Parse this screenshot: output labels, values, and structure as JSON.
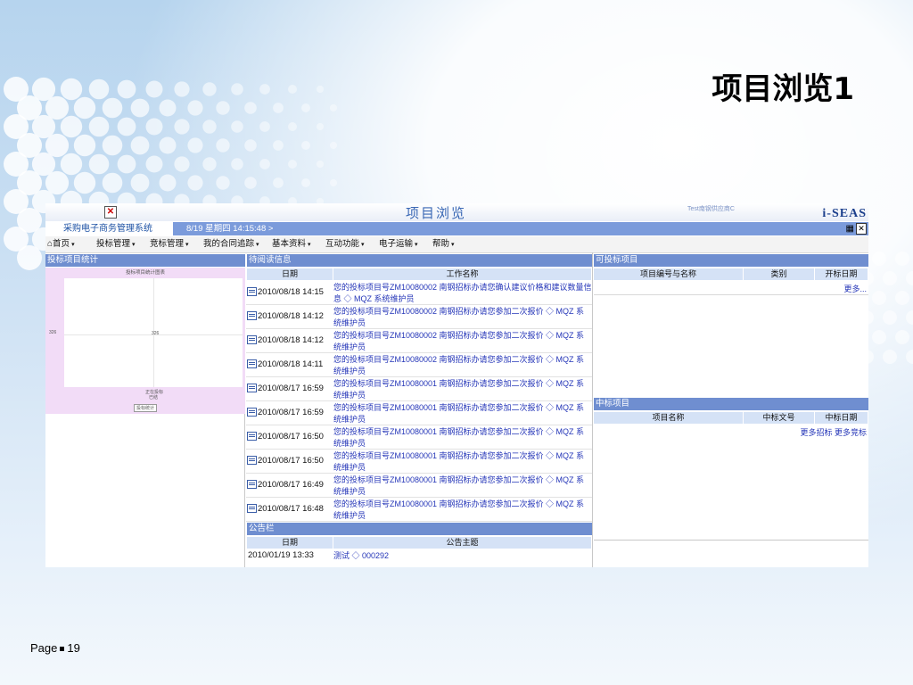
{
  "slide": {
    "title": "项目浏览1",
    "page_label": "Page",
    "page_number": "19"
  },
  "window": {
    "title": "项目浏览",
    "close_glyph": "✕",
    "user_text": "Test南钢供应商C",
    "logo": "i-SEAS",
    "system_name": "采购电子商务管理系统",
    "datetime": "8/19 星期四  14:15:48 >"
  },
  "menu": [
    {
      "label": "首页",
      "icon": "home-icon"
    },
    {
      "label": "投标管理"
    },
    {
      "label": "竞标管理"
    },
    {
      "label": "我的合同追踪"
    },
    {
      "label": "基本资料"
    },
    {
      "label": "互动功能"
    },
    {
      "label": "电子运输"
    },
    {
      "label": "帮助"
    }
  ],
  "stats_panel": {
    "header": "投标项目统计",
    "chart_title": "投标项目统计图表",
    "y_value": "326",
    "x_labels": [
      "正在投标",
      "已结"
    ],
    "button_label": "投标统计"
  },
  "pending_panel": {
    "header": "待阅读信息",
    "columns": [
      "日期",
      "工作名称"
    ],
    "rows": [
      {
        "date": "2010/08/18 14:15",
        "text": "您的投标项目号ZM10080002 南钢招标办请您确认建议价格和建议数量信息 ◇ MQZ 系统维护员"
      },
      {
        "date": "2010/08/18 14:12",
        "text": "您的投标项目号ZM10080002 南钢招标办请您参加二次报价 ◇ MQZ 系统维护员"
      },
      {
        "date": "2010/08/18 14:12",
        "text": "您的投标项目号ZM10080002 南钢招标办请您参加二次报价 ◇ MQZ 系统维护员"
      },
      {
        "date": "2010/08/18 14:11",
        "text": "您的投标项目号ZM10080002 南钢招标办请您参加二次报价 ◇ MQZ 系统维护员"
      },
      {
        "date": "2010/08/17 16:59",
        "text": "您的投标项目号ZM10080001 南钢招标办请您参加二次报价 ◇ MQZ 系统维护员"
      },
      {
        "date": "2010/08/17 16:59",
        "text": "您的投标项目号ZM10080001 南钢招标办请您参加二次报价 ◇ MQZ 系统维护员"
      },
      {
        "date": "2010/08/17 16:50",
        "text": "您的投标项目号ZM10080001 南钢招标办请您参加二次报价 ◇ MQZ 系统维护员"
      },
      {
        "date": "2010/08/17 16:50",
        "text": "您的投标项目号ZM10080001 南钢招标办请您参加二次报价 ◇ MQZ 系统维护员"
      },
      {
        "date": "2010/08/17 16:49",
        "text": "您的投标项目号ZM10080001 南钢招标办请您参加二次报价 ◇ MQZ 系统维护员"
      },
      {
        "date": "2010/08/17 16:48",
        "text": "您的投标项目号ZM10080001 南钢招标办请您参加二次报价 ◇ MQZ 系统维护员"
      }
    ]
  },
  "notice_panel": {
    "header": "公告栏",
    "columns": [
      "日期",
      "公告主题"
    ],
    "rows": [
      {
        "date": "2010/01/19 13:33",
        "text": "测试 ◇ 000292"
      }
    ]
  },
  "bid_panel": {
    "header": "可投标项目",
    "columns": [
      "项目编号与名称",
      "类别",
      "开标日期"
    ],
    "more": "更多..."
  },
  "won_panel": {
    "header": "中标项目",
    "columns": [
      "项目名称",
      "中标文号",
      "中标日期"
    ],
    "more_links": [
      "更多招标",
      "更多竞标"
    ]
  },
  "colors": {
    "panel_header": "#6f8ed0",
    "column_header": "#d5e2f6",
    "link": "#2536b8"
  }
}
